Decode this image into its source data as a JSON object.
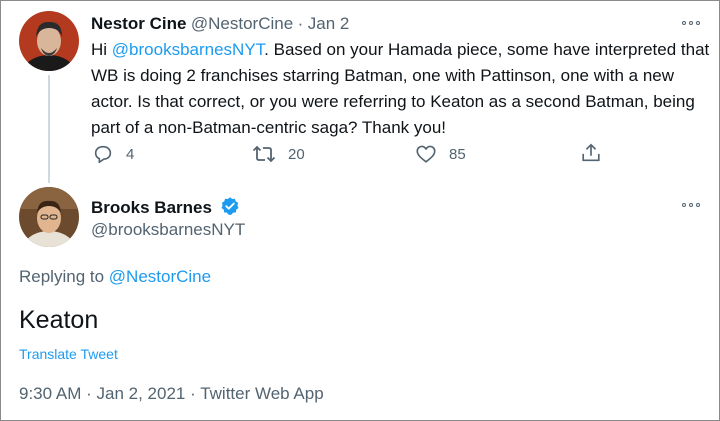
{
  "original_tweet": {
    "author_name": "Nestor Cine",
    "handle": "@NestorCine",
    "separator": "·",
    "date": "Jan 2",
    "text_before_mention": "Hi ",
    "mention": "@brooksbarnesNYT",
    "text_after_mention": ". Based on your Hamada piece, some have interpreted that WB is doing 2 franchises starring Batman, one with Pattinson, one with a new actor. Is that correct, or you were referring to Keaton as a second Batman, being part of a non-Batman-centric saga? Thank you!",
    "reply_count": "4",
    "retweet_count": "20",
    "like_count": "85",
    "icons": [
      "reply-icon",
      "retweet-icon",
      "like-icon",
      "share-icon",
      "more-icon"
    ]
  },
  "reply_tweet": {
    "author_name": "Brooks Barnes",
    "handle": "@brooksbarnesNYT",
    "verified": true,
    "replying_to_label": "Replying to",
    "replying_to_handle": "@NestorCine",
    "text": "Keaton",
    "translate_label": "Translate Tweet",
    "time": "9:30 AM",
    "meta_separator": "·",
    "full_date": "Jan 2, 2021",
    "source": "Twitter Web App"
  },
  "colors": {
    "link": "#1d9bf0",
    "secondary_text": "#536471",
    "primary_text": "#0f1419",
    "thread_line": "#cfd9de"
  }
}
